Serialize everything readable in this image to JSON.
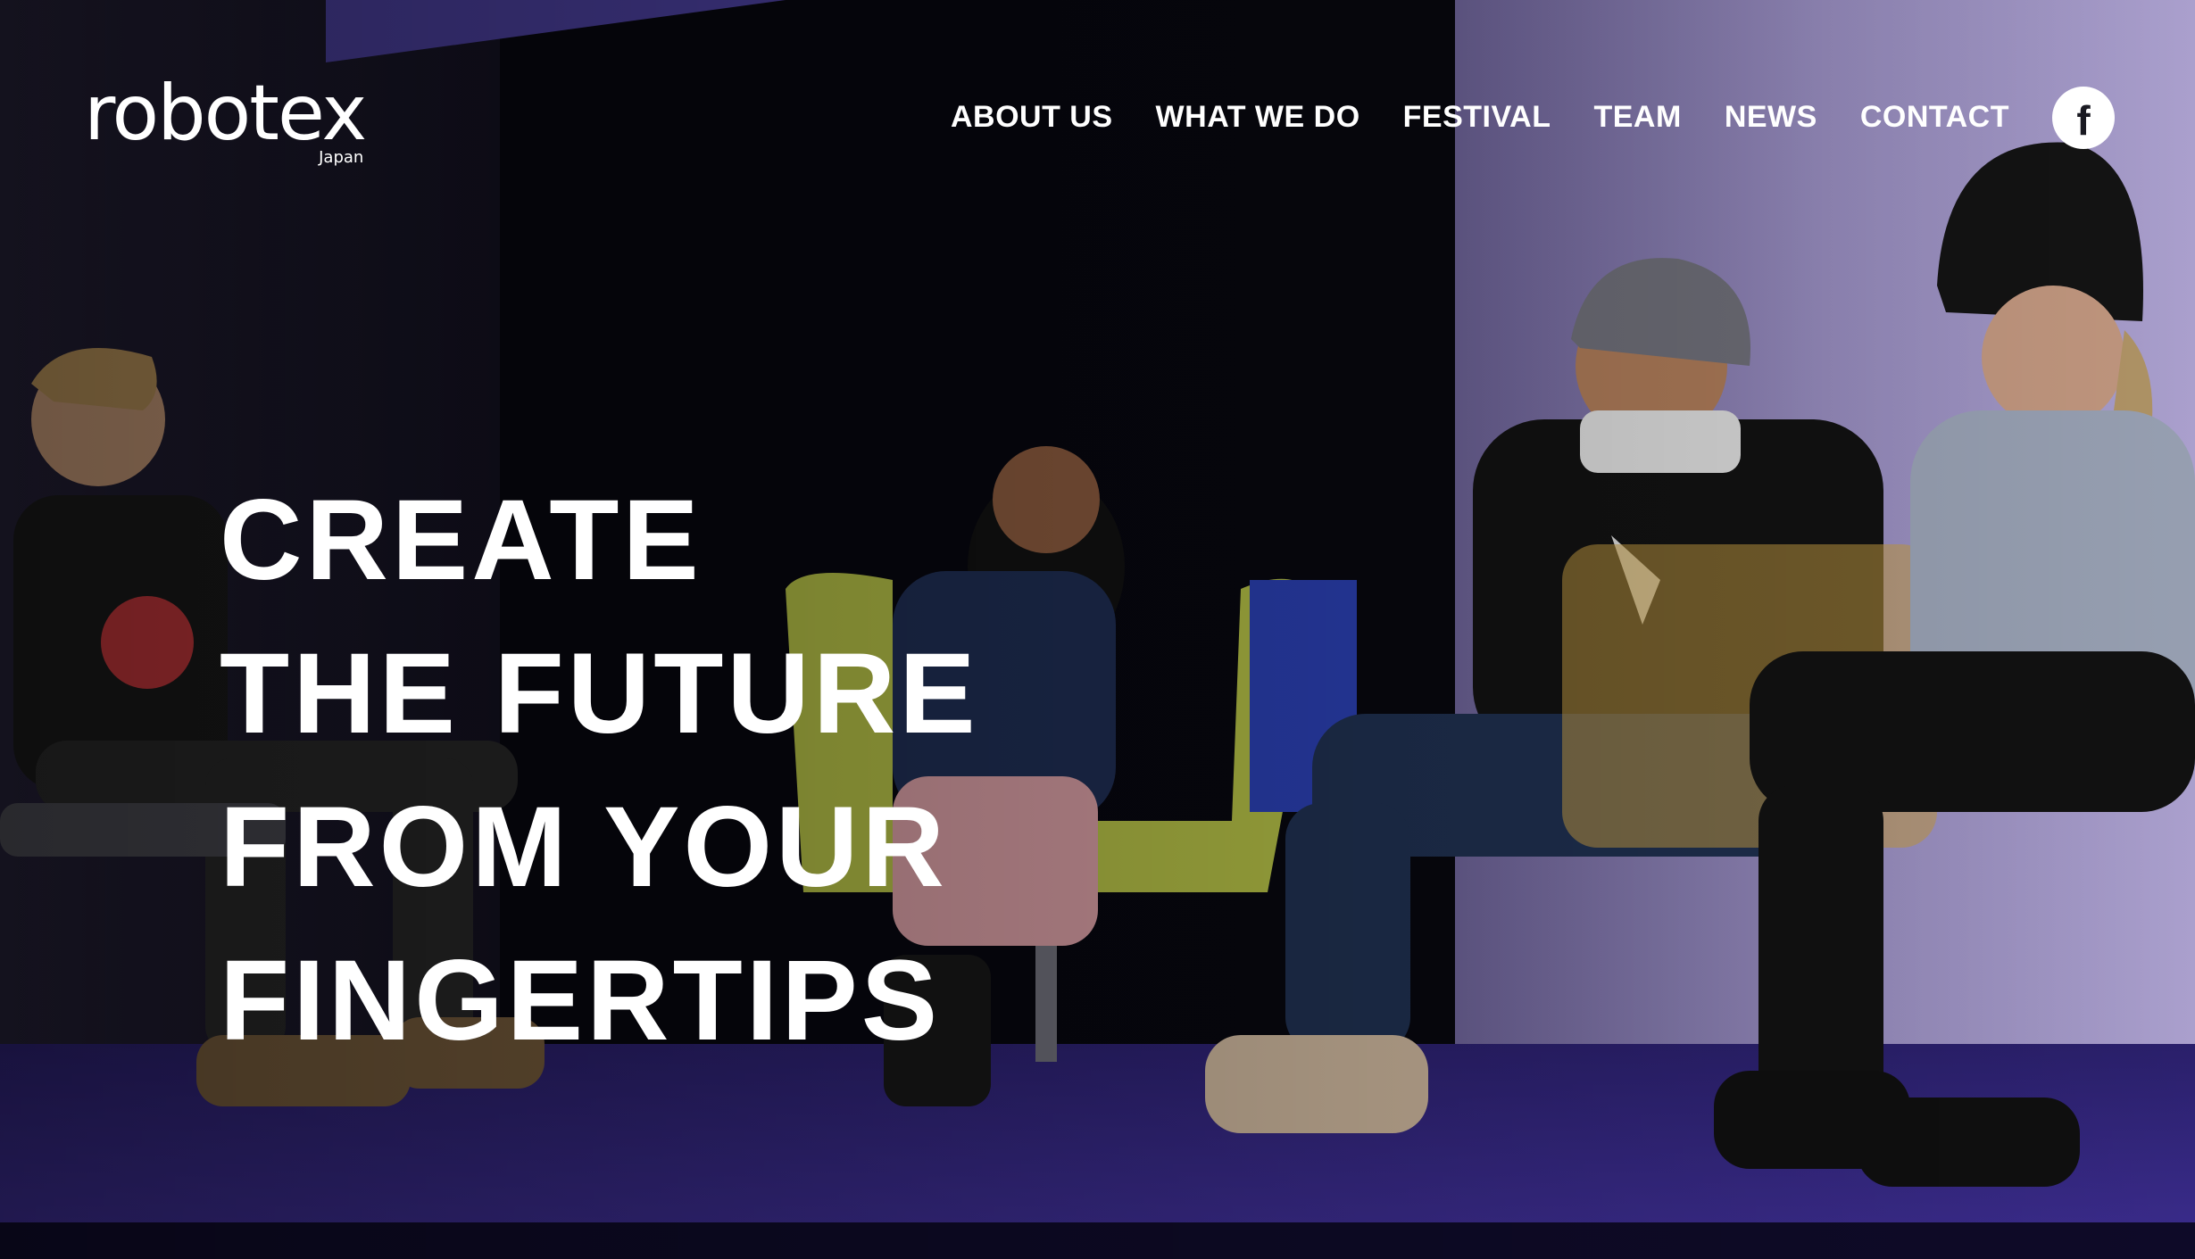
{
  "brand": {
    "logo_text": "robotex",
    "logo_subtext": "Japan"
  },
  "nav": {
    "items": [
      {
        "label": "ABOUT US"
      },
      {
        "label": "WHAT WE DO"
      },
      {
        "label": "FESTIVAL"
      },
      {
        "label": "TEAM"
      },
      {
        "label": "NEWS"
      },
      {
        "label": "CONTACT"
      }
    ],
    "social": {
      "icon": "facebook-icon",
      "glyph": "f"
    }
  },
  "hero": {
    "headline_lines": [
      "CREATE",
      "THE FUTURE",
      "FROM YOUR",
      "FINGERTIPS"
    ]
  },
  "colors": {
    "text": "#ffffff",
    "stage_floor": "#3a2a86",
    "wall": "#9c8fc4",
    "chair_green": "#b7c24a",
    "chair_yellow": "#c99a2a"
  }
}
